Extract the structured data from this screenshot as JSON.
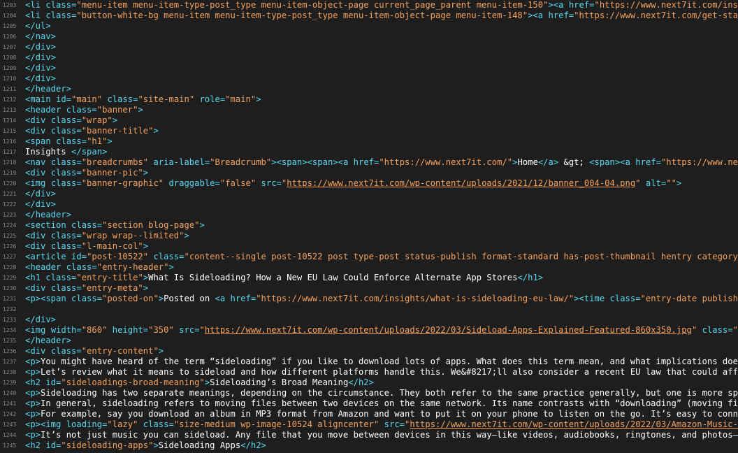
{
  "editor": {
    "colors": {
      "background": "#1e1e1e",
      "tag": "#57d9f0",
      "attr": "#57d9f0",
      "value": "#f5a25d",
      "text": "#ffffff",
      "line_number": "#8a8a8a"
    },
    "lines": [
      {
        "n": "1203",
        "tokens": [
          {
            "t": "tag",
            "v": "<li "
          },
          {
            "t": "attr",
            "v": "class="
          },
          {
            "t": "val",
            "v": "\"menu-item menu-item-type-post_type menu-item-object-page current_page_parent menu-item-150\""
          },
          {
            "t": "tag",
            "v": "><a "
          },
          {
            "t": "attr",
            "v": "href="
          },
          {
            "t": "val",
            "v": "\"https://www.next7it.com/insight"
          }
        ]
      },
      {
        "n": "1204",
        "tokens": [
          {
            "t": "tag",
            "v": "<li "
          },
          {
            "t": "attr",
            "v": "class="
          },
          {
            "t": "val",
            "v": "\"button-white-bg menu-item menu-item-type-post_type menu-item-object-page menu-item-148\""
          },
          {
            "t": "tag",
            "v": "><a "
          },
          {
            "t": "attr",
            "v": "href="
          },
          {
            "t": "val",
            "v": "\"https://www.next7it.com/get-started"
          }
        ]
      },
      {
        "n": "1205",
        "tokens": [
          {
            "t": "tag",
            "v": "</ul>"
          }
        ]
      },
      {
        "n": "1206",
        "tokens": [
          {
            "t": "tag",
            "v": "</nav>"
          }
        ]
      },
      {
        "n": "1207",
        "tokens": [
          {
            "t": "tag",
            "v": "</div>"
          }
        ]
      },
      {
        "n": "1208",
        "tokens": [
          {
            "t": "tag",
            "v": "</div>"
          }
        ]
      },
      {
        "n": "1209",
        "tokens": [
          {
            "t": "tag",
            "v": "</div>"
          }
        ]
      },
      {
        "n": "1210",
        "tokens": [
          {
            "t": "tag",
            "v": "</div>"
          }
        ]
      },
      {
        "n": "1211",
        "tokens": [
          {
            "t": "tag",
            "v": "</header>"
          }
        ]
      },
      {
        "n": "1212",
        "tokens": [
          {
            "t": "tag",
            "v": "<main "
          },
          {
            "t": "attr",
            "v": "id="
          },
          {
            "t": "val",
            "v": "\"main\""
          },
          {
            "t": "attr",
            "v": " class="
          },
          {
            "t": "val",
            "v": "\"site-main\""
          },
          {
            "t": "attr",
            "v": " role="
          },
          {
            "t": "val",
            "v": "\"main\""
          },
          {
            "t": "tag",
            "v": ">"
          }
        ]
      },
      {
        "n": "1213",
        "tokens": [
          {
            "t": "tag",
            "v": "<header "
          },
          {
            "t": "attr",
            "v": "class="
          },
          {
            "t": "val",
            "v": "\"banner\""
          },
          {
            "t": "tag",
            "v": ">"
          }
        ]
      },
      {
        "n": "1214",
        "tokens": [
          {
            "t": "tag",
            "v": "<div "
          },
          {
            "t": "attr",
            "v": "class="
          },
          {
            "t": "val",
            "v": "\"wrap\""
          },
          {
            "t": "tag",
            "v": ">"
          }
        ]
      },
      {
        "n": "1215",
        "tokens": [
          {
            "t": "tag",
            "v": "<div "
          },
          {
            "t": "attr",
            "v": "class="
          },
          {
            "t": "val",
            "v": "\"banner-title\""
          },
          {
            "t": "tag",
            "v": ">"
          }
        ]
      },
      {
        "n": "1216",
        "tokens": [
          {
            "t": "tag",
            "v": "<span "
          },
          {
            "t": "attr",
            "v": "class="
          },
          {
            "t": "val",
            "v": "\"h1\""
          },
          {
            "t": "tag",
            "v": ">"
          }
        ]
      },
      {
        "n": "1217",
        "tokens": [
          {
            "t": "text",
            "v": "Insights "
          },
          {
            "t": "tag",
            "v": "</span>"
          }
        ]
      },
      {
        "n": "1218",
        "tokens": [
          {
            "t": "tag",
            "v": "<nav "
          },
          {
            "t": "attr",
            "v": "class="
          },
          {
            "t": "val",
            "v": "\"breadcrumbs\""
          },
          {
            "t": "attr",
            "v": " aria-label="
          },
          {
            "t": "val",
            "v": "\"Breadcrumb\""
          },
          {
            "t": "tag",
            "v": "><span><span><a "
          },
          {
            "t": "attr",
            "v": "href="
          },
          {
            "t": "val",
            "v": "\"https://www.next7it.com/\""
          },
          {
            "t": "tag",
            "v": ">"
          },
          {
            "t": "text",
            "v": "Home"
          },
          {
            "t": "tag",
            "v": "</a>"
          },
          {
            "t": "text",
            "v": " &gt; "
          },
          {
            "t": "tag",
            "v": "<span><a "
          },
          {
            "t": "attr",
            "v": "href="
          },
          {
            "t": "val",
            "v": "\"https://www.next7i"
          }
        ]
      },
      {
        "n": "1219",
        "tokens": [
          {
            "t": "tag",
            "v": "<div "
          },
          {
            "t": "attr",
            "v": "class="
          },
          {
            "t": "val",
            "v": "\"banner-pic\""
          },
          {
            "t": "tag",
            "v": ">"
          }
        ]
      },
      {
        "n": "1220",
        "tokens": [
          {
            "t": "tag",
            "v": "<img "
          },
          {
            "t": "attr",
            "v": "class="
          },
          {
            "t": "val",
            "v": "\"banner-graphic\""
          },
          {
            "t": "attr",
            "v": " draggable="
          },
          {
            "t": "val",
            "v": "\"false\""
          },
          {
            "t": "attr",
            "v": " src="
          },
          {
            "t": "val",
            "v": "\""
          },
          {
            "t": "url",
            "v": "https://www.next7it.com/wp-content/uploads/2021/12/banner_004-04.png"
          },
          {
            "t": "val",
            "v": "\""
          },
          {
            "t": "attr",
            "v": " alt="
          },
          {
            "t": "val",
            "v": "\"\""
          },
          {
            "t": "tag",
            "v": ">"
          }
        ]
      },
      {
        "n": "1221",
        "tokens": [
          {
            "t": "tag",
            "v": "</div>"
          }
        ]
      },
      {
        "n": "1222",
        "tokens": [
          {
            "t": "tag",
            "v": "</div>"
          }
        ]
      },
      {
        "n": "1223",
        "tokens": [
          {
            "t": "tag",
            "v": "</header>"
          }
        ]
      },
      {
        "n": "1224",
        "tokens": [
          {
            "t": "tag",
            "v": "<section "
          },
          {
            "t": "attr",
            "v": "class="
          },
          {
            "t": "val",
            "v": "\"section blog-page\""
          },
          {
            "t": "tag",
            "v": ">"
          }
        ]
      },
      {
        "n": "1225",
        "tokens": [
          {
            "t": "tag",
            "v": "<div "
          },
          {
            "t": "attr",
            "v": "class="
          },
          {
            "t": "val",
            "v": "\"wrap wrap--limited\""
          },
          {
            "t": "tag",
            "v": ">"
          }
        ]
      },
      {
        "n": "1226",
        "tokens": [
          {
            "t": "tag",
            "v": "<div "
          },
          {
            "t": "attr",
            "v": "class="
          },
          {
            "t": "val",
            "v": "\"l-main-col\""
          },
          {
            "t": "tag",
            "v": ">"
          }
        ]
      },
      {
        "n": "1227",
        "tokens": [
          {
            "t": "tag",
            "v": "<article "
          },
          {
            "t": "attr",
            "v": "id="
          },
          {
            "t": "val",
            "v": "\"post-10522\""
          },
          {
            "t": "attr",
            "v": " class="
          },
          {
            "t": "val",
            "v": "\"content--single post-10522 post type-post status-publish format-standard has-post-thumbnail hentry category-sec"
          }
        ]
      },
      {
        "n": "1228",
        "tokens": [
          {
            "t": "tag",
            "v": "<header "
          },
          {
            "t": "attr",
            "v": "class="
          },
          {
            "t": "val",
            "v": "\"entry-header\""
          },
          {
            "t": "tag",
            "v": ">"
          }
        ]
      },
      {
        "n": "1229",
        "tokens": [
          {
            "t": "tag",
            "v": "<h1 "
          },
          {
            "t": "attr",
            "v": "class="
          },
          {
            "t": "val",
            "v": "\"entry-title\""
          },
          {
            "t": "tag",
            "v": ">"
          },
          {
            "t": "text",
            "v": "What Is Sideloading? How a New EU Law Could Enforce Alternate App Stores"
          },
          {
            "t": "tag",
            "v": "</h1>"
          }
        ]
      },
      {
        "n": "1230",
        "tokens": [
          {
            "t": "tag",
            "v": "<div "
          },
          {
            "t": "attr",
            "v": "class="
          },
          {
            "t": "val",
            "v": "\"entry-meta\""
          },
          {
            "t": "tag",
            "v": ">"
          }
        ]
      },
      {
        "n": "1231",
        "tokens": [
          {
            "t": "tag",
            "v": "<p><span "
          },
          {
            "t": "attr",
            "v": "class="
          },
          {
            "t": "val",
            "v": "\"posted-on\""
          },
          {
            "t": "tag",
            "v": ">"
          },
          {
            "t": "text",
            "v": "Posted on "
          },
          {
            "t": "tag",
            "v": "<a "
          },
          {
            "t": "attr",
            "v": "href="
          },
          {
            "t": "val",
            "v": "\"https://www.next7it.com/insights/what-is-sideloading-eu-law/\""
          },
          {
            "t": "tag",
            "v": "><time "
          },
          {
            "t": "attr",
            "v": "class="
          },
          {
            "t": "val",
            "v": "\"entry-date published\""
          }
        ]
      },
      {
        "n": "1232",
        "tokens": []
      },
      {
        "n": "1233",
        "tokens": [
          {
            "t": "tag",
            "v": "</div>"
          }
        ]
      },
      {
        "n": "1234",
        "tokens": [
          {
            "t": "tag",
            "v": "<img "
          },
          {
            "t": "attr",
            "v": "width="
          },
          {
            "t": "val",
            "v": "\"860\""
          },
          {
            "t": "attr",
            "v": " height="
          },
          {
            "t": "val",
            "v": "\"350\""
          },
          {
            "t": "attr",
            "v": " src="
          },
          {
            "t": "val",
            "v": "\""
          },
          {
            "t": "url",
            "v": "https://www.next7it.com/wp-content/uploads/2022/03/Sideload-Apps-Explained-Featured-860x350.jpg"
          },
          {
            "t": "val",
            "v": "\""
          },
          {
            "t": "attr",
            "v": " class="
          },
          {
            "t": "val",
            "v": "\"atta"
          }
        ]
      },
      {
        "n": "1235",
        "tokens": [
          {
            "t": "tag",
            "v": "</header>"
          }
        ]
      },
      {
        "n": "1236",
        "tokens": [
          {
            "t": "tag",
            "v": "<div "
          },
          {
            "t": "attr",
            "v": "class="
          },
          {
            "t": "val",
            "v": "\"entry-content\""
          },
          {
            "t": "tag",
            "v": ">"
          }
        ]
      },
      {
        "n": "1237",
        "tokens": [
          {
            "t": "tag",
            "v": "<p>"
          },
          {
            "t": "text",
            "v": "You might have heard of the term “sideloading” if you like to download lots of apps. What does this term mean, and what implications does it"
          }
        ]
      },
      {
        "n": "1238",
        "tokens": [
          {
            "t": "tag",
            "v": "<p>"
          },
          {
            "t": "text",
            "v": "Let’s review what it means to sideload and how different platforms handle this. We&#8217;ll also consider a recent EU law that could affect"
          }
        ]
      },
      {
        "n": "1239",
        "tokens": [
          {
            "t": "tag",
            "v": "<h2 "
          },
          {
            "t": "attr",
            "v": "id="
          },
          {
            "t": "val",
            "v": "\"sideloadings-broad-meaning\""
          },
          {
            "t": "tag",
            "v": ">"
          },
          {
            "t": "text",
            "v": "Sideloading’s Broad Meaning"
          },
          {
            "t": "tag",
            "v": "</h2>"
          }
        ]
      },
      {
        "n": "1240",
        "tokens": [
          {
            "t": "tag",
            "v": "<p>"
          },
          {
            "t": "text",
            "v": "Sideloading has two separate meanings, depending on the circumstance. They both refer to the same practice generally, but one is more specif"
          }
        ]
      },
      {
        "n": "1241",
        "tokens": [
          {
            "t": "tag",
            "v": "<p>"
          },
          {
            "t": "text",
            "v": "In general, sideloading refers to moving files between two devices on the same network. Its name contrasts with “downloading” (moving files"
          }
        ]
      },
      {
        "n": "1242",
        "tokens": [
          {
            "t": "tag",
            "v": "<p>"
          },
          {
            "t": "text",
            "v": "For example, say you download an album in MP3 format from Amazon and want to put it on your phone to listen on the go. It’s easy to connect"
          }
        ]
      },
      {
        "n": "1243",
        "tokens": [
          {
            "t": "tag",
            "v": "<p><img "
          },
          {
            "t": "attr",
            "v": "loading="
          },
          {
            "t": "val",
            "v": "\"lazy\""
          },
          {
            "t": "attr",
            "v": " class="
          },
          {
            "t": "val",
            "v": "\"size-medium wp-image-10524 aligncenter\""
          },
          {
            "t": "attr",
            "v": " src="
          },
          {
            "t": "val",
            "v": "\""
          },
          {
            "t": "url",
            "v": "https://www.next7it.com/wp-content/uploads/2022/03/Amazon-Music-Down"
          }
        ]
      },
      {
        "n": "1244",
        "tokens": [
          {
            "t": "tag",
            "v": "<p>"
          },
          {
            "t": "text",
            "v": "It’s not just music you can sideload. Any file that you move between devices in this way—like videos, audiobooks, ringtones, and photos—coun"
          }
        ]
      },
      {
        "n": "1245",
        "tokens": [
          {
            "t": "tag",
            "v": "<h2 "
          },
          {
            "t": "attr",
            "v": "id="
          },
          {
            "t": "val",
            "v": "\"sideloading-apps\""
          },
          {
            "t": "tag",
            "v": ">"
          },
          {
            "t": "text",
            "v": "Sideloading Apps"
          },
          {
            "t": "tag",
            "v": "</h2>"
          }
        ]
      }
    ]
  }
}
